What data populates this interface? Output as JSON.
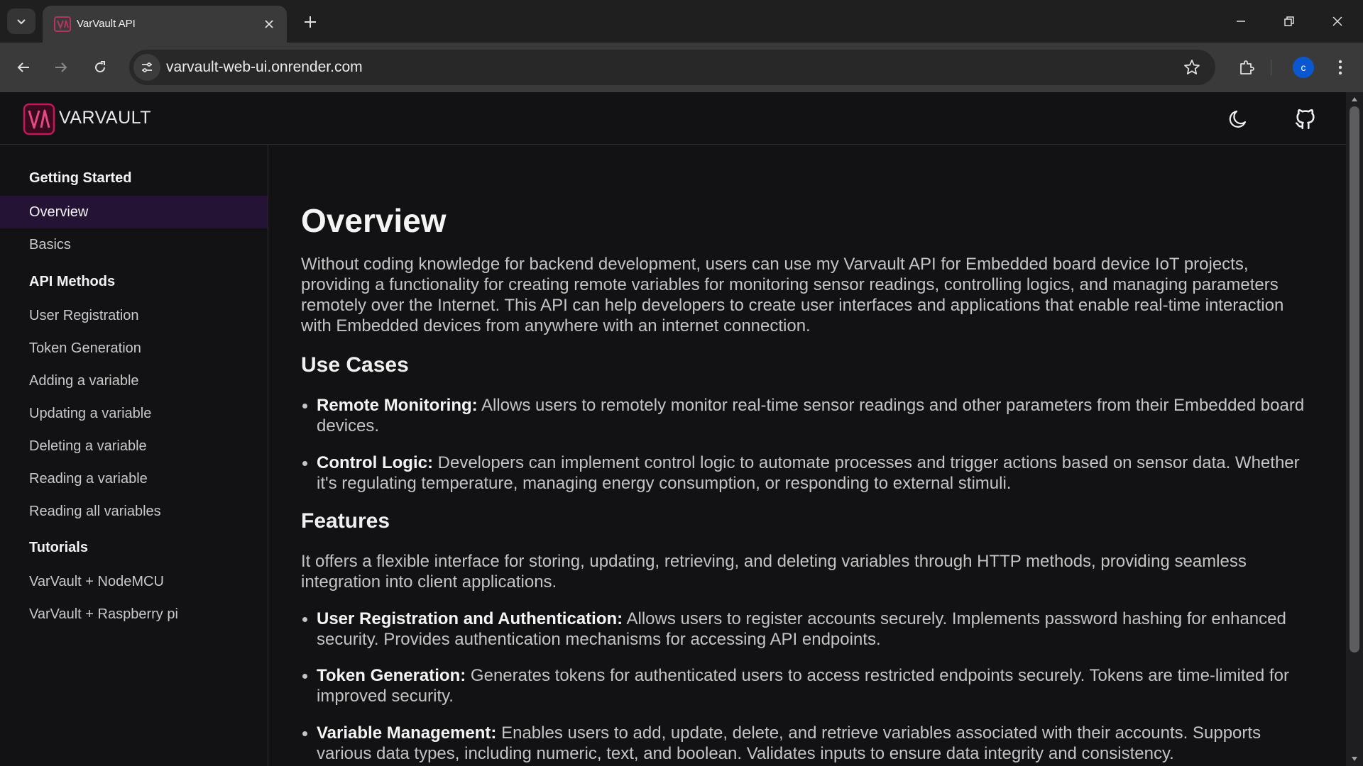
{
  "browser": {
    "tab_title": "VarVault API",
    "url": "varvault-web-ui.onrender.com",
    "profile_initial": "c",
    "icons": [
      "tab-search-icon",
      "close-icon",
      "plus-icon",
      "minimize-icon",
      "restore-icon",
      "window-close-icon",
      "back-icon",
      "forward-icon",
      "reload-icon",
      "site-info-icon",
      "star-icon",
      "extensions-icon",
      "kebab-menu-icon"
    ]
  },
  "header": {
    "logo_text": "VARVAULT",
    "icons": [
      "moon-icon",
      "github-icon"
    ]
  },
  "sidebar": {
    "sections": [
      {
        "title": "Getting Started",
        "items": [
          {
            "label": "Overview",
            "active": true
          },
          {
            "label": "Basics"
          }
        ]
      },
      {
        "title": "API Methods",
        "items": [
          {
            "label": "User Registration"
          },
          {
            "label": "Token Generation"
          },
          {
            "label": "Adding a variable"
          },
          {
            "label": "Updating a variable"
          },
          {
            "label": "Deleting a variable"
          },
          {
            "label": "Reading a variable"
          },
          {
            "label": "Reading all variables"
          }
        ]
      },
      {
        "title": "Tutorials",
        "items": [
          {
            "label": "VarVault + NodeMCU"
          },
          {
            "label": "VarVault + Raspberry pi"
          }
        ]
      }
    ]
  },
  "content": {
    "title": "Overview",
    "intro": "Without coding knowledge for backend development, users can use my Varvault API for Embedded board device IoT projects, providing a functionality for creating remote variables for monitoring sensor readings, controlling logics, and managing parameters remotely over the Internet. This API can help developers to create user interfaces and applications that enable real-time interaction with Embedded devices from anywhere with an internet connection.",
    "use_cases_heading": "Use Cases",
    "use_cases": [
      {
        "term": "Remote Monitoring:",
        "text": "Allows users to remotely monitor real-time sensor readings and other parameters from their Embedded board devices."
      },
      {
        "term": "Control Logic:",
        "text": "Developers can implement control logic to automate processes and trigger actions based on sensor data. Whether it's regulating temperature, managing energy consumption, or responding to external stimuli."
      }
    ],
    "features_heading": "Features",
    "features_intro": "It offers a flexible interface for storing, updating, retrieving, and deleting variables through HTTP methods, providing seamless integration into client applications.",
    "features": [
      {
        "term": "User Registration and Authentication:",
        "text": "Allows users to register accounts securely. Implements password hashing for enhanced security. Provides authentication mechanisms for accessing API endpoints."
      },
      {
        "term": "Token Generation:",
        "text": "Generates tokens for authenticated users to access restricted endpoints securely. Tokens are time-limited for improved security."
      },
      {
        "term": "Variable Management:",
        "text": "Enables users to add, update, delete, and retrieve variables associated with their accounts. Supports various data types, including numeric, text, and boolean. Validates inputs to ensure data integrity and consistency."
      }
    ]
  },
  "colors": {
    "page_bg": "#121214",
    "active_nav_bg": "#241335",
    "brand": "#c2185b",
    "profile": "#0b57d0"
  }
}
